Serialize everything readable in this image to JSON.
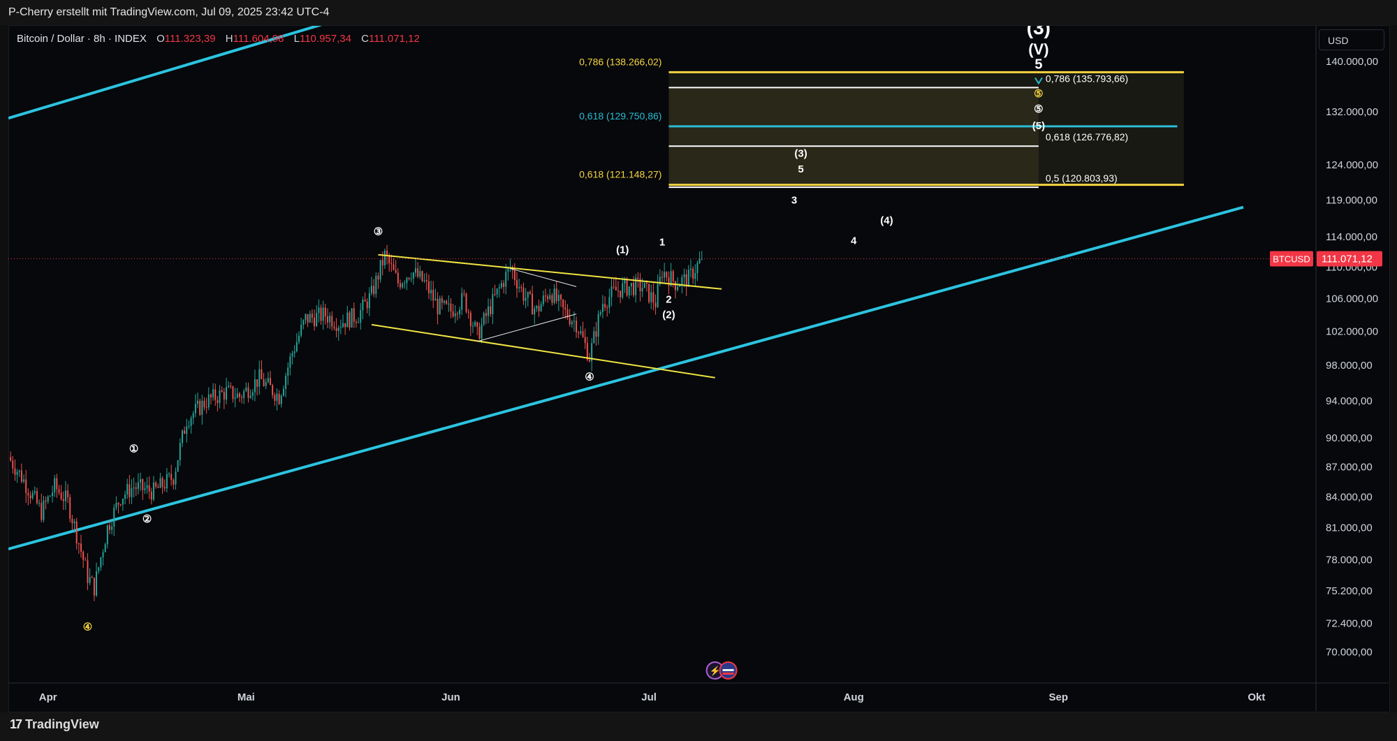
{
  "header": {
    "attribution": "P-Cherry erstellt mit TradingView.com, Jul 09, 2025 23:42 UTC-4"
  },
  "legend": {
    "symbol": "Bitcoin / Dollar · 8h · INDEX",
    "open_label": "O",
    "open": "111.323,39",
    "high_label": "H",
    "high": "111.604,98",
    "low_label": "L",
    "low": "110.957,34",
    "close_label": "C",
    "close": "111.071,12"
  },
  "currency_button": "USD",
  "footer": {
    "brand": "TradingView"
  },
  "colors": {
    "background": "#06080b",
    "up": "#26a69a",
    "down": "#ef5350",
    "channel": "#2bc4e0",
    "wedge": "#f0e442",
    "fib_yellow": "#f5d442",
    "fib_cyan": "#2bbcd4",
    "price_tag": "#f23645"
  },
  "chart_data": {
    "type": "candlestick",
    "title": "Bitcoin / Dollar · 8h · INDEX",
    "timeframe": "8h",
    "x_range": [
      "2025-03-26",
      "2025-10-10"
    ],
    "ylim": [
      67500,
      146000
    ],
    "y_scale": "log",
    "y_ticks": [
      {
        "value": 70000,
        "label": "70.000,00"
      },
      {
        "value": 72400,
        "label": "72.400,00"
      },
      {
        "value": 75200,
        "label": "75.200,00"
      },
      {
        "value": 78000,
        "label": "78.000,00"
      },
      {
        "value": 81000,
        "label": "81.000,00"
      },
      {
        "value": 84000,
        "label": "84.000,00"
      },
      {
        "value": 87000,
        "label": "87.000,00"
      },
      {
        "value": 90000,
        "label": "90.000,00"
      },
      {
        "value": 94000,
        "label": "94.000,00"
      },
      {
        "value": 98000,
        "label": "98.000,00"
      },
      {
        "value": 102000,
        "label": "102.000,00"
      },
      {
        "value": 106000,
        "label": "106.000,00"
      },
      {
        "value": 110000,
        "label": "110.000,00"
      },
      {
        "value": 114000,
        "label": "114.000,00"
      },
      {
        "value": 119000,
        "label": "119.000,00"
      },
      {
        "value": 124000,
        "label": "124.000,00"
      },
      {
        "value": 132000,
        "label": "132.000,00"
      },
      {
        "value": 140000,
        "label": "140.000,00"
      }
    ],
    "x_ticks": [
      {
        "date": "2025-04-01",
        "label": "Apr"
      },
      {
        "date": "2025-05-01",
        "label": "Mai"
      },
      {
        "date": "2025-06-01",
        "label": "Jun"
      },
      {
        "date": "2025-07-01",
        "label": "Jul"
      },
      {
        "date": "2025-08-01",
        "label": "Aug"
      },
      {
        "date": "2025-09-01",
        "label": "Sep"
      },
      {
        "date": "2025-10-01",
        "label": "Okt"
      }
    ],
    "price_tag": {
      "symbol": "BTCUSD",
      "value": 111071.12,
      "label": "111.071,12"
    },
    "price_path": [
      [
        "2025-03-26",
        88000
      ],
      [
        "2025-03-28",
        86000
      ],
      [
        "2025-03-31",
        82500
      ],
      [
        "2025-04-02",
        85000
      ],
      [
        "2025-04-04",
        83500
      ],
      [
        "2025-04-07",
        76500
      ],
      [
        "2025-04-08",
        75500
      ],
      [
        "2025-04-10",
        81000
      ],
      [
        "2025-04-12",
        84000
      ],
      [
        "2025-04-14",
        85000
      ],
      [
        "2025-04-17",
        84500
      ],
      [
        "2025-04-20",
        86000
      ],
      [
        "2025-04-22",
        92000
      ],
      [
        "2025-04-25",
        94000
      ],
      [
        "2025-04-28",
        95000
      ],
      [
        "2025-04-30",
        94500
      ],
      [
        "2025-05-03",
        96500
      ],
      [
        "2025-05-06",
        94500
      ],
      [
        "2025-05-08",
        99500
      ],
      [
        "2025-05-10",
        103500
      ],
      [
        "2025-05-13",
        104000
      ],
      [
        "2025-05-15",
        103000
      ],
      [
        "2025-05-18",
        104000
      ],
      [
        "2025-05-20",
        106500
      ],
      [
        "2025-05-22",
        111500
      ],
      [
        "2025-05-24",
        108000
      ],
      [
        "2025-05-26",
        109500
      ],
      [
        "2025-05-28",
        108000
      ],
      [
        "2025-05-30",
        105000
      ],
      [
        "2025-06-01",
        104500
      ],
      [
        "2025-06-03",
        106000
      ],
      [
        "2025-06-05",
        101500
      ],
      [
        "2025-06-07",
        105000
      ],
      [
        "2025-06-10",
        110000
      ],
      [
        "2025-06-12",
        106500
      ],
      [
        "2025-06-14",
        104500
      ],
      [
        "2025-06-16",
        107000
      ],
      [
        "2025-06-18",
        104500
      ],
      [
        "2025-06-20",
        103000
      ],
      [
        "2025-06-22",
        99000
      ],
      [
        "2025-06-24",
        105500
      ],
      [
        "2025-06-26",
        107000
      ],
      [
        "2025-06-28",
        107500
      ],
      [
        "2025-06-30",
        107500
      ],
      [
        "2025-07-02",
        105500
      ],
      [
        "2025-07-03",
        109500
      ],
      [
        "2025-07-05",
        108000
      ],
      [
        "2025-07-07",
        108500
      ],
      [
        "2025-07-09",
        111071.12
      ]
    ],
    "channel_lines": [
      {
        "from": [
          "2025-03-26",
          79000
        ],
        "to": [
          "2025-09-29",
          118000
        ]
      },
      {
        "from": [
          "2025-03-26",
          131000
        ],
        "to": [
          "2025-06-01",
          153000
        ]
      }
    ],
    "wedge_lines": [
      {
        "from": [
          "2025-05-21",
          111600
        ],
        "to": [
          "2025-07-12",
          107200
        ]
      },
      {
        "from": [
          "2025-05-20",
          102800
        ],
        "to": [
          "2025-07-11",
          96600
        ]
      }
    ],
    "thin_lines": [
      {
        "from": [
          "2025-06-05",
          100800
        ],
        "to": [
          "2025-06-20",
          104100
        ]
      },
      {
        "from": [
          "2025-06-10",
          109800
        ],
        "to": [
          "2025-06-20",
          107500
        ]
      }
    ],
    "fib_levels": [
      {
        "label": "0,786 (138.266,02)",
        "value": 138266.02,
        "color": "#f5d442",
        "from": "2025-07-04",
        "to": "2025-09-20",
        "label_side": "left"
      },
      {
        "label": "0,618 (129.750,86)",
        "value": 129750.86,
        "color": "#2bbcd4",
        "from": "2025-07-04",
        "to": "2025-09-19",
        "label_side": "left"
      },
      {
        "label": "0,618 (121.148,27)",
        "value": 121148.27,
        "color": "#f5d442",
        "from": "2025-07-04",
        "to": "2025-09-20",
        "label_side": "left"
      },
      {
        "label": "0,786 (135.793,66)",
        "value": 135793.66,
        "color": "#ffffff",
        "from": "2025-07-04",
        "to": "2025-08-29",
        "label_side": "right"
      },
      {
        "label": "0,618 (126.776,82)",
        "value": 126776.82,
        "color": "#ffffff",
        "from": "2025-07-04",
        "to": "2025-08-29",
        "label_side": "right"
      },
      {
        "label": "0,5 (120.803,93)",
        "value": 120803.93,
        "color": "#ffffff",
        "from": "2025-07-04",
        "to": "2025-08-29",
        "label_side": "right"
      }
    ],
    "wave_labels": [
      {
        "text": "③",
        "date": "2025-05-21",
        "price": 114200,
        "color": "#ffffff"
      },
      {
        "text": "④",
        "date": "2025-06-22",
        "price": 96300,
        "color": "#ffffff"
      },
      {
        "text": "①",
        "date": "2025-04-14",
        "price": 88500,
        "color": "#ffffff"
      },
      {
        "text": "②",
        "date": "2025-04-16",
        "price": 81500,
        "color": "#ffffff"
      },
      {
        "text": "④",
        "date": "2025-04-07",
        "price": 71800,
        "color": "#f5d442"
      },
      {
        "text": "(1)",
        "date": "2025-06-27",
        "price": 111800,
        "color": "#ffffff"
      },
      {
        "text": "1",
        "date": "2025-07-03",
        "price": 112800,
        "color": "#ffffff"
      },
      {
        "text": "2",
        "date": "2025-07-04",
        "price": 105500,
        "color": "#ffffff"
      },
      {
        "text": "(2)",
        "date": "2025-07-04",
        "price": 103600,
        "color": "#ffffff"
      },
      {
        "text": "3",
        "date": "2025-07-23",
        "price": 118500,
        "color": "#ffffff"
      },
      {
        "text": "4",
        "date": "2025-08-01",
        "price": 113000,
        "color": "#ffffff"
      },
      {
        "text": "(4)",
        "date": "2025-08-06",
        "price": 115700,
        "color": "#ffffff"
      },
      {
        "text": "(3)",
        "date": "2025-07-24",
        "price": 125200,
        "color": "#ffffff"
      },
      {
        "text": "5",
        "date": "2025-07-24",
        "price": 122900,
        "color": "#ffffff"
      },
      {
        "text": "⑤",
        "date": "2025-08-29",
        "price": 131900,
        "color": "#ffffff"
      },
      {
        "text": "(5)",
        "date": "2025-08-29",
        "price": 129300,
        "color": "#ffffff"
      },
      {
        "text": "⑤",
        "date": "2025-08-29",
        "price": 134300,
        "color": "#f5d442"
      },
      {
        "text": "5",
        "date": "2025-08-29",
        "price": 138800,
        "color": "#ffffff"
      },
      {
        "text": "(V)",
        "date": "2025-08-29",
        "price": 141200,
        "color": "#ffffff"
      },
      {
        "text": "(3)",
        "date": "2025-08-29",
        "price": 144600,
        "color": "#ffffff"
      }
    ]
  }
}
